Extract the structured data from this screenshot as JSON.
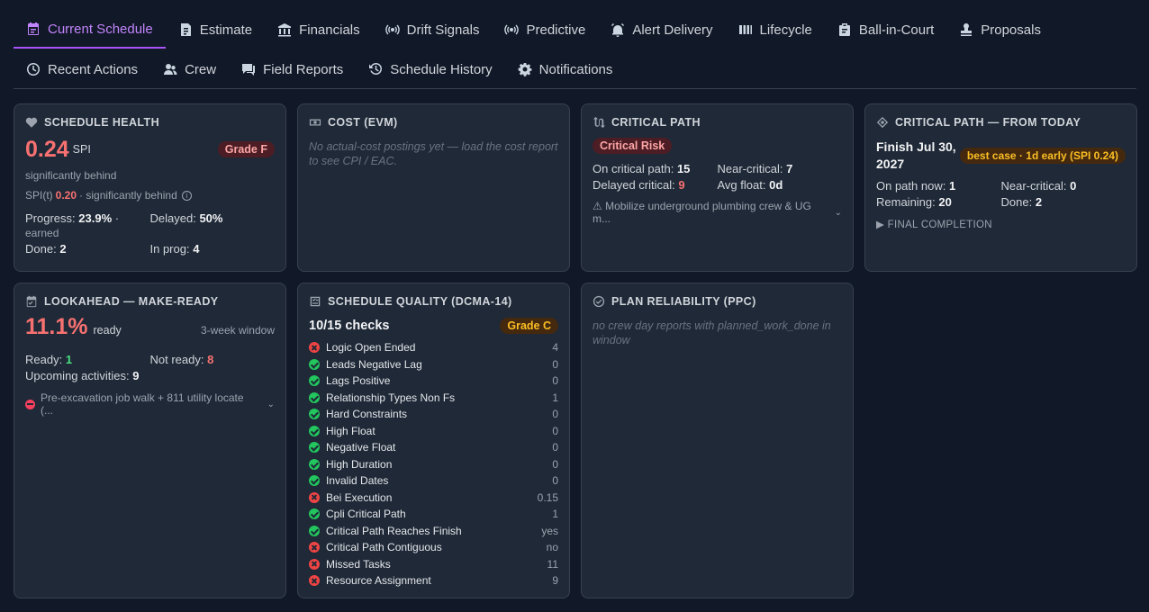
{
  "nav": {
    "row1": [
      {
        "label": "Current Schedule",
        "icon": "calendar-icon",
        "active": true
      },
      {
        "label": "Estimate",
        "icon": "receipt-icon"
      },
      {
        "label": "Financials",
        "icon": "bank-icon"
      },
      {
        "label": "Drift Signals",
        "icon": "signal-icon"
      },
      {
        "label": "Predictive",
        "icon": "radar-icon"
      },
      {
        "label": "Alert Delivery",
        "icon": "alarm-icon"
      },
      {
        "label": "Lifecycle",
        "icon": "columns-icon"
      },
      {
        "label": "Ball-in-Court",
        "icon": "clipboard-icon"
      },
      {
        "label": "Proposals",
        "icon": "stamp-icon"
      }
    ],
    "row2": [
      {
        "label": "Recent Actions",
        "icon": "clock-icon"
      },
      {
        "label": "Crew",
        "icon": "crew-icon"
      },
      {
        "label": "Field Reports",
        "icon": "chat-icon"
      },
      {
        "label": "Schedule History",
        "icon": "history-icon"
      },
      {
        "label": "Notifications",
        "icon": "gear-icon"
      }
    ]
  },
  "health": {
    "title": "Schedule Health",
    "spi": "0.24",
    "spi_unit": "SPI",
    "grade": "Grade F",
    "status": "significantly behind",
    "spit_label": "SPI(t)",
    "spit_value": "0.20",
    "spit_status": "· significantly behind",
    "progress_label": "Progress:",
    "progress_value": "23.9%",
    "progress_suffix": "·",
    "progress_sub": "earned",
    "delayed_label": "Delayed:",
    "delayed_value": "50%",
    "done_label": "Done:",
    "done_value": "2",
    "inprog_label": "In prog:",
    "inprog_value": "4"
  },
  "cost": {
    "title": "Cost (EVM)",
    "empty_text": "No actual-cost postings yet — load the cost report to see CPI / EAC."
  },
  "critical": {
    "title": "Critical Path",
    "risk": "Critical Risk",
    "on_path_label": "On critical path:",
    "on_path_value": "15",
    "near_label": "Near-critical:",
    "near_value": "7",
    "delayed_label": "Delayed critical:",
    "delayed_value": "9",
    "float_label": "Avg float:",
    "float_value": "0d",
    "warning": "⚠ Mobilize underground plumbing crew & UG m..."
  },
  "today": {
    "title": "Critical Path — From Today",
    "finish": "Finish Jul 30, 2027",
    "badge": "best case · 1d early (SPI 0.24)",
    "on_path_label": "On path now:",
    "on_path_value": "1",
    "near_label": "Near-critical:",
    "near_value": "0",
    "remaining_label": "Remaining:",
    "remaining_value": "20",
    "done_label": "Done:",
    "done_value": "2",
    "final": "FINAL COMPLETION"
  },
  "lookahead": {
    "title": "Lookahead — Make-Ready",
    "pct": "11.1%",
    "pct_unit": "ready",
    "window": "3-week window",
    "ready_label": "Ready:",
    "ready_value": "1",
    "notready_label": "Not ready:",
    "notready_value": "8",
    "upcoming_label": "Upcoming activities:",
    "upcoming_value": "9",
    "blocker": "Pre-excavation job walk + 811 utility locate (..."
  },
  "quality": {
    "title": "Schedule Quality (DCMA-14)",
    "checks": "10/15 checks",
    "grade": "Grade C",
    "items": [
      {
        "label": "Logic Open Ended",
        "value": "4",
        "pass": false
      },
      {
        "label": "Leads Negative Lag",
        "value": "0",
        "pass": true
      },
      {
        "label": "Lags Positive",
        "value": "0",
        "pass": true
      },
      {
        "label": "Relationship Types Non Fs",
        "value": "1",
        "pass": true
      },
      {
        "label": "Hard Constraints",
        "value": "0",
        "pass": true
      },
      {
        "label": "High Float",
        "value": "0",
        "pass": true
      },
      {
        "label": "Negative Float",
        "value": "0",
        "pass": true
      },
      {
        "label": "High Duration",
        "value": "0",
        "pass": true
      },
      {
        "label": "Invalid Dates",
        "value": "0",
        "pass": true
      },
      {
        "label": "Bei Execution",
        "value": "0.15",
        "pass": false
      },
      {
        "label": "Cpli Critical Path",
        "value": "1",
        "pass": true
      },
      {
        "label": "Critical Path Reaches Finish",
        "value": "yes",
        "pass": true
      },
      {
        "label": "Critical Path Contiguous",
        "value": "no",
        "pass": false
      },
      {
        "label": "Missed Tasks",
        "value": "11",
        "pass": false
      },
      {
        "label": "Resource Assignment",
        "value": "9",
        "pass": false
      }
    ]
  },
  "ppc": {
    "title": "Plan Reliability (PPC)",
    "empty_text": "no crew day reports with planned_work_done in window"
  }
}
